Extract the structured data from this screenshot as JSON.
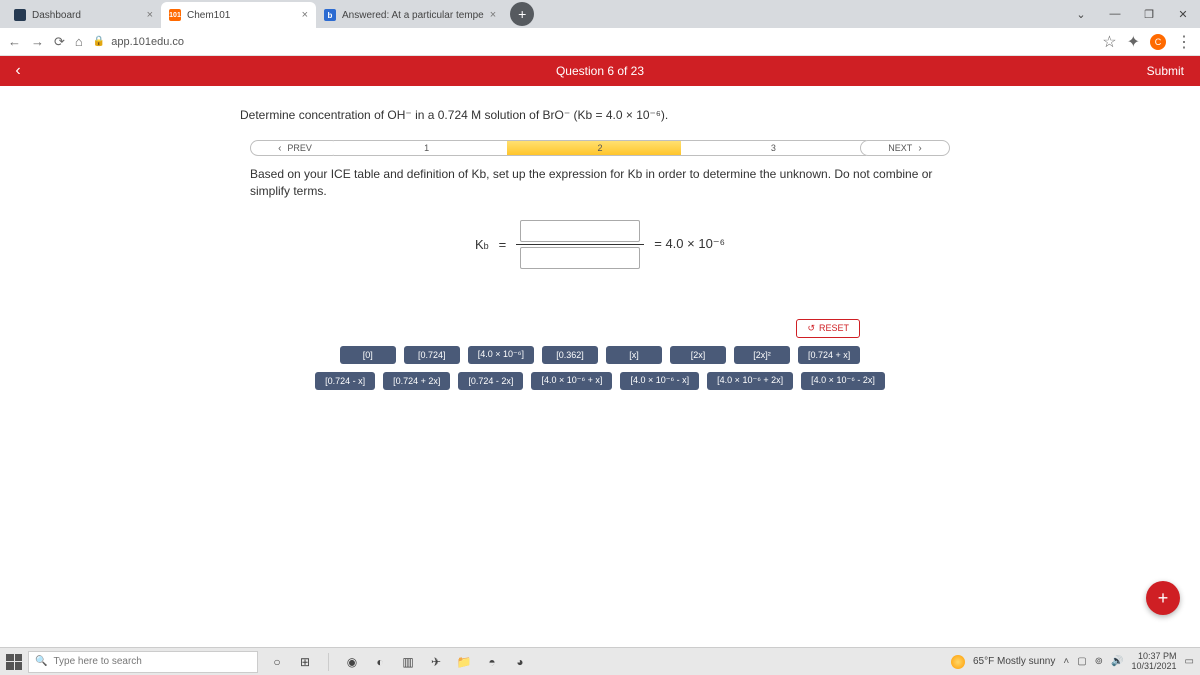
{
  "tabs": [
    {
      "label": "Dashboard"
    },
    {
      "label": "Chem101"
    },
    {
      "label": "Answered: At a particular tempe"
    }
  ],
  "url": "app.101edu.co",
  "header": {
    "question": "Question 6 of 23",
    "submit": "Submit"
  },
  "prompt": "Determine concentration of OH⁻ in a 0.724 M solution of BrO⁻ (Kb = 4.0 × 10⁻⁶).",
  "steps": {
    "prev": "PREV",
    "s1": "1",
    "s2": "2",
    "s3": "3",
    "next": "NEXT"
  },
  "instr": "Based on your ICE table and definition of Kb, set up the expression for Kb in order to determine the unknown. Do not combine or simplify terms.",
  "eq": {
    "k": "K",
    "sub": "b",
    "eqs": "=",
    "rhs": "=  4.0 × 10⁻⁶"
  },
  "reset": "RESET",
  "tiles": {
    "r1": [
      "[0]",
      "[0.724]",
      "[4.0 × 10⁻⁶]",
      "[0.362]",
      "[x]",
      "[2x]",
      "[2x]²",
      "[0.724 + x]"
    ],
    "r2": [
      "[0.724 - x]",
      "[0.724 + 2x]",
      "[0.724 - 2x]",
      "[4.0 × 10⁻⁶ + x]",
      "[4.0 × 10⁻⁶ - x]",
      "[4.0 × 10⁻⁶ + 2x]",
      "[4.0 × 10⁻⁶ - 2x]"
    ]
  },
  "taskbar": {
    "search": "Type here to search",
    "weather": "65°F Mostly sunny",
    "time": "10:37 PM",
    "date": "10/31/2021"
  }
}
